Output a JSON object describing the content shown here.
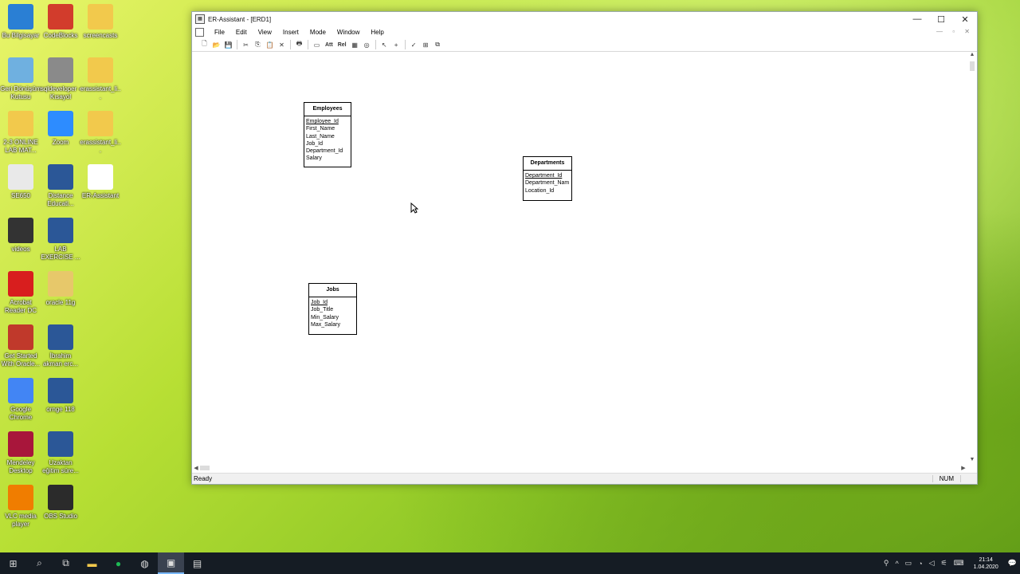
{
  "desktop": {
    "icons": [
      {
        "label": "Bu Bilgisayar",
        "icon": "computer-icon",
        "color": "#2a7fd4"
      },
      {
        "label": "CodeBlocks",
        "icon": "codeblocks-icon",
        "color": "#d23c2c"
      },
      {
        "label": "screencasts",
        "icon": "folder-icon",
        "color": "#f2c94c"
      },
      {
        "label": "Geri Dönüşüm Kutusu",
        "icon": "recycle-bin-icon",
        "color": "#6fb0e0"
      },
      {
        "label": "sqldeveloper - Kısayol",
        "icon": "database-icon",
        "color": "#8a8a8a"
      },
      {
        "label": "erassistant_li...",
        "icon": "folder-icon",
        "color": "#f2c94c"
      },
      {
        "label": "2-3 ONLINE LAB MAT...",
        "icon": "folder-icon",
        "color": "#f2c94c"
      },
      {
        "label": "Zoom",
        "icon": "zoom-icon",
        "color": "#2d8cff"
      },
      {
        "label": "erassistant_li...",
        "icon": "folder-icon",
        "color": "#f2c94c"
      },
      {
        "label": "SE650",
        "icon": "pdf-file-icon",
        "color": "#e9e9e9"
      },
      {
        "label": "Distance Educati...",
        "icon": "word-doc-icon",
        "color": "#2b5797"
      },
      {
        "label": "ER-Assistant",
        "icon": "er-assistant-icon",
        "color": "#ffffff"
      },
      {
        "label": "videos",
        "icon": "video-file-icon",
        "color": "#333333"
      },
      {
        "label": "LAB EXERCISE ...",
        "icon": "word-doc-icon",
        "color": "#2b5797"
      },
      {
        "label": "Acrobat Reader DC",
        "icon": "acrobat-icon",
        "color": "#d81e1e"
      },
      {
        "label": "oracle 11g",
        "icon": "zip-folder-icon",
        "color": "#e7c86a"
      },
      {
        "label": "Get Started With Oracle...",
        "icon": "oracle-xe-icon",
        "color": "#c0392b"
      },
      {
        "label": "İbrahim akman erc...",
        "icon": "word-doc-icon",
        "color": "#2b5797"
      },
      {
        "label": "Google Chrome",
        "icon": "chrome-icon",
        "color": "#4285f4"
      },
      {
        "label": "ornge 118",
        "icon": "word-doc-icon",
        "color": "#2b5797"
      },
      {
        "label": "Mendeley Desktop",
        "icon": "mendeley-icon",
        "color": "#a8163b"
      },
      {
        "label": "Uzaktan eğitim süre...",
        "icon": "word-doc-icon",
        "color": "#2b5797"
      },
      {
        "label": "VLC media player",
        "icon": "vlc-icon",
        "color": "#f07d00"
      },
      {
        "label": "OBS Studio",
        "icon": "obs-icon",
        "color": "#2b2b2b"
      }
    ]
  },
  "window": {
    "title": "ER-Assistant - [ERD1]",
    "menu": [
      "File",
      "Edit",
      "View",
      "Insert",
      "Mode",
      "Window",
      "Help"
    ],
    "toolbar": {
      "attr_label": "Att",
      "rel_label": "Rel"
    },
    "status_text": "Ready",
    "status_num": "NUM"
  },
  "entities": [
    {
      "name": "Employees",
      "attributes": [
        "Employee_Id",
        "First_Name",
        "Last_Name",
        "Job_Id",
        "Department_Id",
        "Salary"
      ],
      "key": "Employee_Id"
    },
    {
      "name": "Departments",
      "attributes": [
        "Department_Id",
        "Department_Nam",
        "Location_Id"
      ],
      "key": "Department_Id"
    },
    {
      "name": "Jobs",
      "attributes": [
        "Job_Id",
        "Job_Title",
        "Min_Salary",
        "Max_Salary"
      ],
      "key": "Job_Id"
    }
  ],
  "taskbar": {
    "clock_time": "21:14",
    "clock_date": "1.04.2020"
  }
}
